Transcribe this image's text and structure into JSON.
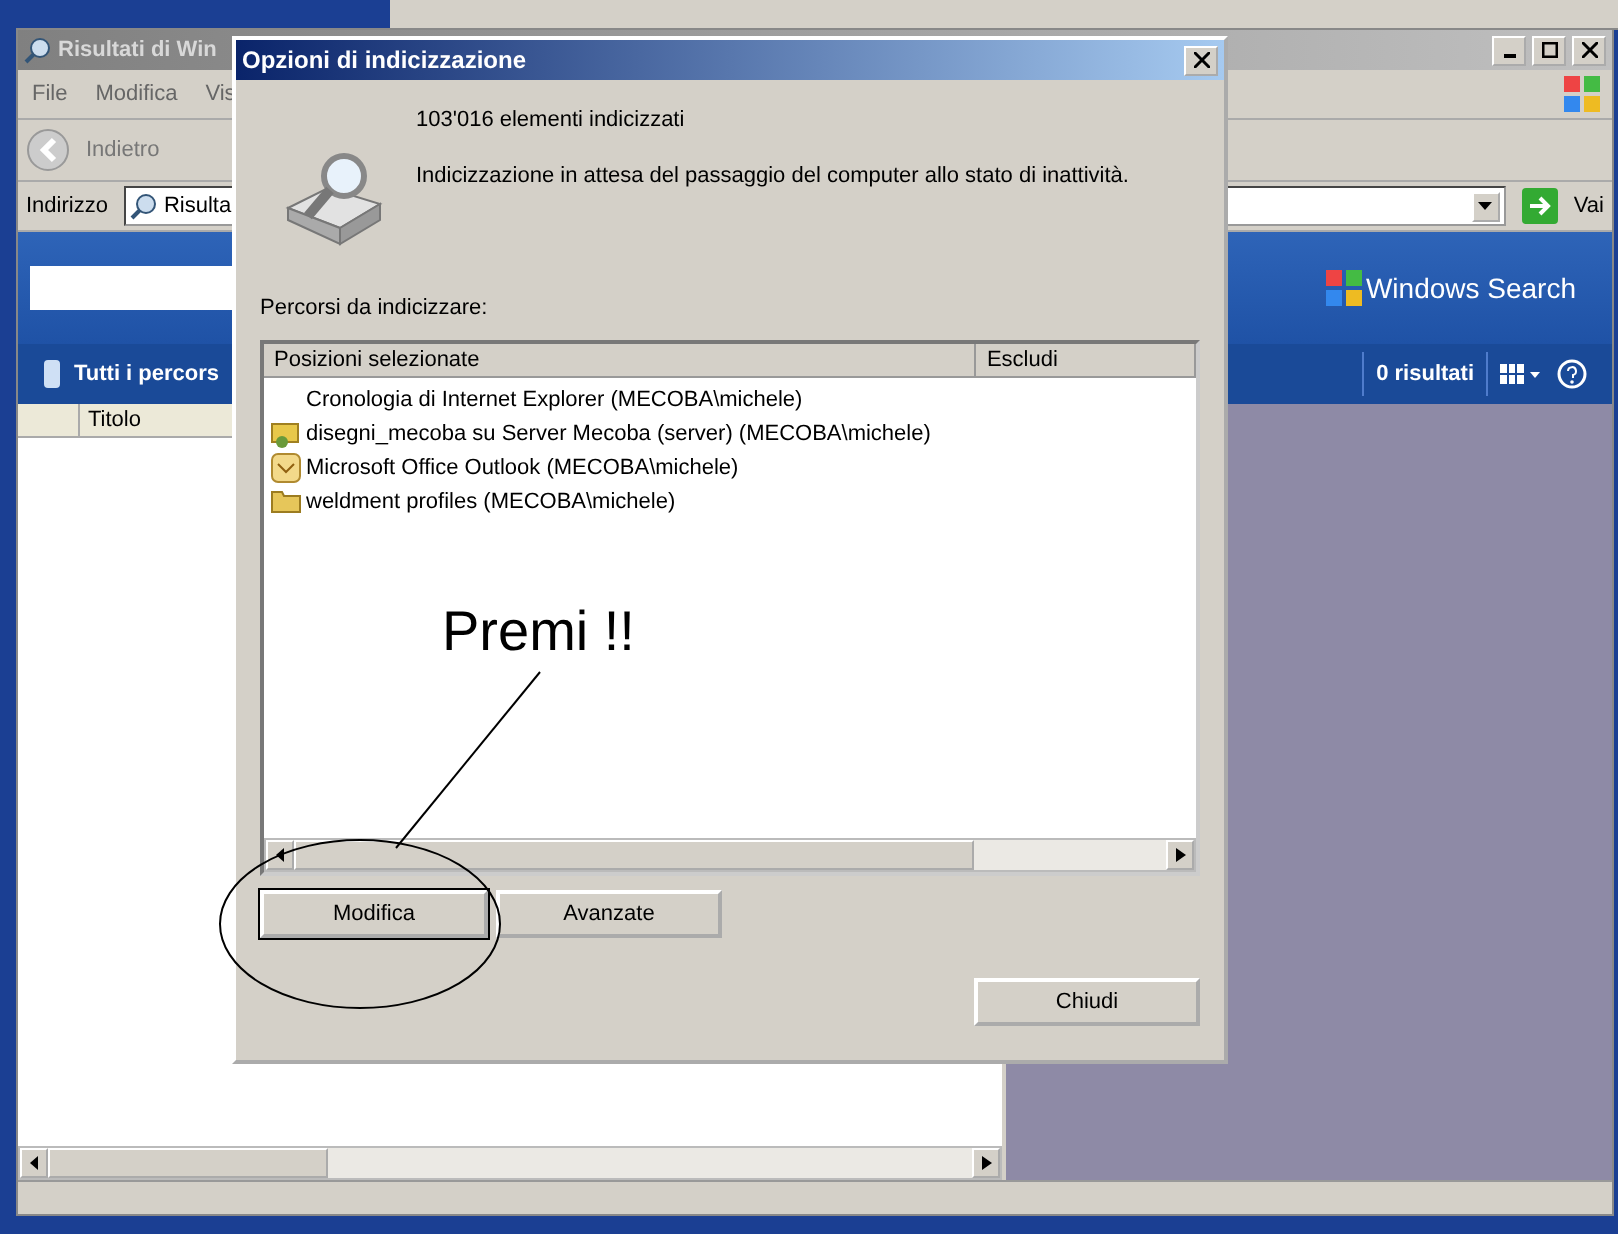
{
  "background_window": {
    "title": "Risultati di Win",
    "menu": [
      "File",
      "Modifica",
      "Vis"
    ],
    "back_button": "Indietro",
    "address_label": "Indirizzo",
    "address_value": "Risulta",
    "go_button": "Vai",
    "brand": "Windows Search",
    "scope": "Tutti i percors",
    "result_count": "0 risultati",
    "columns": [
      "Titolo"
    ]
  },
  "dialog": {
    "title": "Opzioni di indicizzazione",
    "item_count": "103'016 elementi indicizzati",
    "status": "Indicizzazione in attesa del passaggio del computer allo stato di inattività.",
    "locations_label": "Percorsi da indicizzare:",
    "columns": [
      "Posizioni selezionate",
      "Escludi"
    ],
    "locations": [
      {
        "name": "Cronologia di Internet Explorer (MECOBA\\michele)",
        "kind": "history"
      },
      {
        "name": "disegni_mecoba su Server Mecoba (server) (MECOBA\\michele)",
        "kind": "network"
      },
      {
        "name": "Microsoft Office Outlook (MECOBA\\michele)",
        "kind": "outlook"
      },
      {
        "name": "weldment profiles (MECOBA\\michele)",
        "kind": "folder"
      }
    ],
    "buttons": [
      {
        "label": "Modifica",
        "default": true
      },
      {
        "label": "Avanzate",
        "default": false
      }
    ],
    "close_button": "Chiudi"
  },
  "annotation": {
    "text": "Premi !!"
  }
}
